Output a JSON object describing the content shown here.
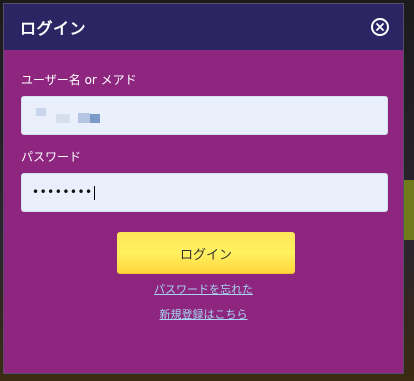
{
  "dialog": {
    "title": "ログイン",
    "close_icon": "close-circle-icon"
  },
  "form": {
    "username": {
      "label": "ユーザー名 or メアド",
      "value_obscured": true
    },
    "password": {
      "label": "パスワード",
      "masked_value": "••••••••"
    },
    "submit_label": "ログイン"
  },
  "links": {
    "forgot_password": "パスワードを忘れた",
    "register": "新規登録はこちら"
  },
  "colors": {
    "header_bg": "#2b2563",
    "body_bg": "#8e267f",
    "button_bg": "#fff15f",
    "link": "#a8d6f0"
  }
}
